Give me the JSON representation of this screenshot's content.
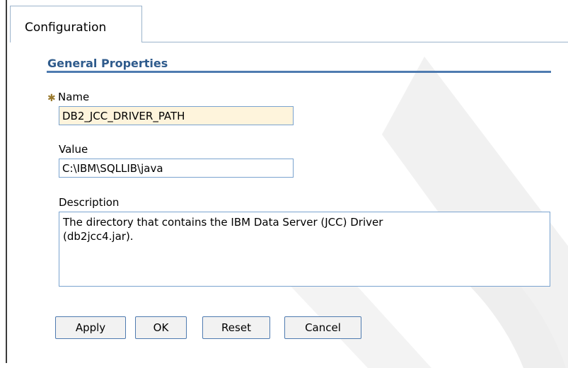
{
  "tabs": [
    {
      "label": "Configuration",
      "active": true
    }
  ],
  "section": {
    "title": "General Properties"
  },
  "fields": {
    "name": {
      "label": "Name",
      "value": "DB2_JCC_DRIVER_PATH",
      "required": true,
      "required_marker": "✱"
    },
    "value": {
      "label": "Value",
      "value": "C:\\IBM\\SQLLIB\\java"
    },
    "description": {
      "label": "Description",
      "value": "The directory that contains the IBM Data Server (JCC) Driver\n(db2jcc4.jar)."
    }
  },
  "buttons": {
    "apply": "Apply",
    "ok": "OK",
    "reset": "Reset",
    "cancel": "Cancel"
  },
  "colors": {
    "section_title": "#2f5b8c",
    "required_field_bg": "#fef4dc",
    "field_border": "#7aa3cf"
  }
}
